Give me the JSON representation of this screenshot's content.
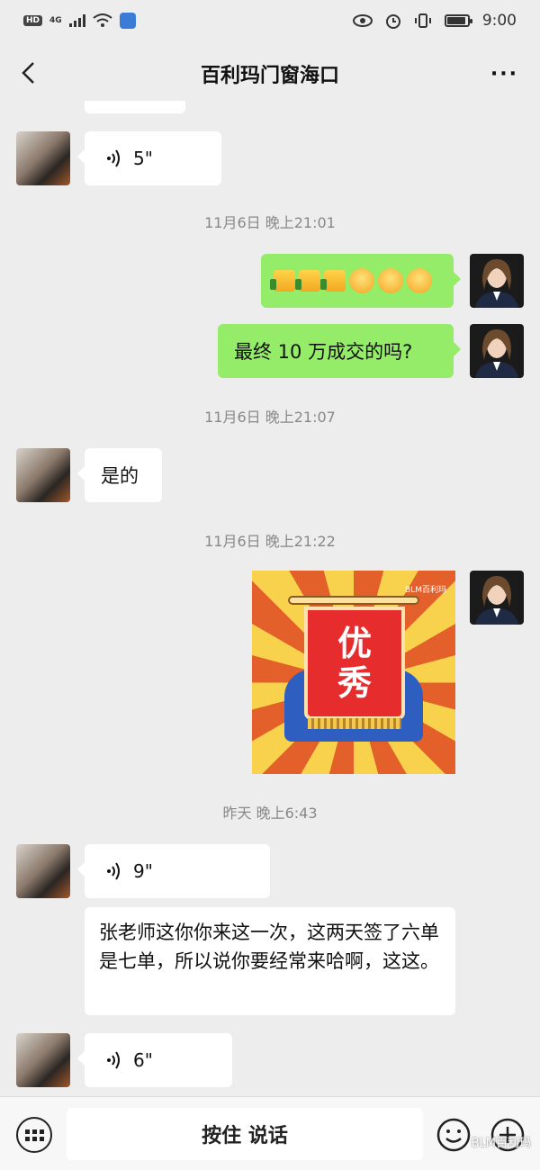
{
  "status_bar": {
    "hd": "HD",
    "network": "4G",
    "time": "9:00",
    "icons": [
      "hd-badge",
      "signal-icon",
      "wifi-icon",
      "app-icon",
      "eye-icon",
      "alarm-icon",
      "vibrate-icon",
      "battery-icon"
    ],
    "battery_level": 0.9
  },
  "header": {
    "title": "百利玛门窗海口",
    "back_icon": "chevron-left-icon",
    "more_label": "···"
  },
  "messages": {
    "voice1": {
      "duration": "5\""
    },
    "time1": "11月6日 晚上21:01",
    "emoji_msg": {
      "icons": [
        "thumbs-up",
        "thumbs-up",
        "thumbs-up",
        "cover-face",
        "cover-face",
        "cover-face"
      ]
    },
    "me_text1": "最终 10 万成交的吗?",
    "time2": "11月6日 晚上21:07",
    "other_text1": "是的",
    "time3": "11月6日 晚上21:22",
    "sticker": {
      "text1": "优",
      "text2": "秀",
      "brand": "BLM百利玛"
    },
    "time4": "昨天 晚上6:43",
    "voice2": {
      "duration": "9\""
    },
    "other_text2": "张老师这你你来这一次，这两天签了六单是七单，所以说你要经常来哈啊，这这。",
    "voice3": {
      "duration": "6\""
    }
  },
  "bottom_bar": {
    "talk_label": "按住 说话",
    "watermark": "BLM百利玛"
  },
  "colors": {
    "bubble_green": "#95ec69",
    "bubble_white": "#ffffff",
    "background": "#ededed"
  }
}
